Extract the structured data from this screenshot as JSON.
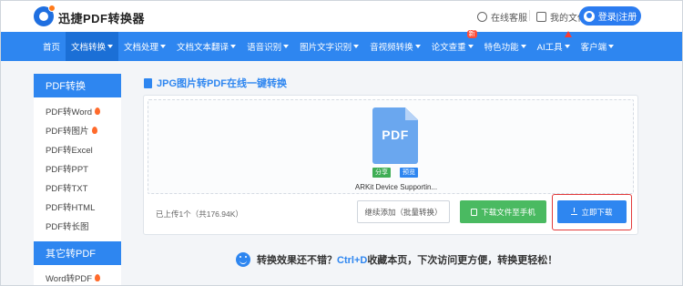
{
  "header": {
    "brand": "迅捷PDF转换器",
    "service_label": "在线客服",
    "files_label": "我的文件",
    "login_label": "登录|注册"
  },
  "nav": {
    "items": [
      {
        "label": "首页"
      },
      {
        "label": "文档转换",
        "dropdown": true,
        "active": true
      },
      {
        "label": "文档处理",
        "dropdown": true
      },
      {
        "label": "文档文本翻译",
        "dropdown": true
      },
      {
        "label": "语音识别",
        "dropdown": true
      },
      {
        "label": "图片文字识别",
        "dropdown": true
      },
      {
        "label": "音视频转换",
        "dropdown": true
      },
      {
        "label": "论文查重",
        "dropdown": true,
        "badge": "新"
      },
      {
        "label": "特色功能",
        "dropdown": true
      },
      {
        "label": "AI工具",
        "dropdown": true,
        "marker": "red-arrow"
      },
      {
        "label": "客户端",
        "dropdown": true
      }
    ]
  },
  "sidebar": {
    "section1_title": "PDF转换",
    "items": [
      {
        "label": "PDF转Word",
        "hot": true
      },
      {
        "label": "PDF转图片",
        "hot": true
      },
      {
        "label": "PDF转Excel"
      },
      {
        "label": "PDF转PPT"
      },
      {
        "label": "PDF转TXT"
      },
      {
        "label": "PDF转HTML"
      },
      {
        "label": "PDF转长图"
      }
    ],
    "section2_title": "其它转PDF",
    "section2_items": [
      {
        "label": "Word转PDF",
        "hot": true
      }
    ]
  },
  "main": {
    "title": "JPG图片转PDF在线一键转换",
    "file": {
      "icon_label": "PDF",
      "share_tag": "分享",
      "preview_tag": "预览",
      "name": "ARKit Device Supportin..."
    },
    "upload_info": "已上传1个（共176.94K）",
    "continue_label": "继续添加（批量转换）",
    "phone_label": "下载文件至手机",
    "download_label": "立即下载"
  },
  "tip": {
    "prefix": "转换效果还不错？",
    "shortcut": "Ctrl+D",
    "suffix": "收藏本页，下次访问更方便，转换更轻松！"
  },
  "colors": {
    "primary": "#2e86f0",
    "green": "#4aba61",
    "highlight_border": "#e23a3a",
    "hot": "#ff6a2b"
  }
}
